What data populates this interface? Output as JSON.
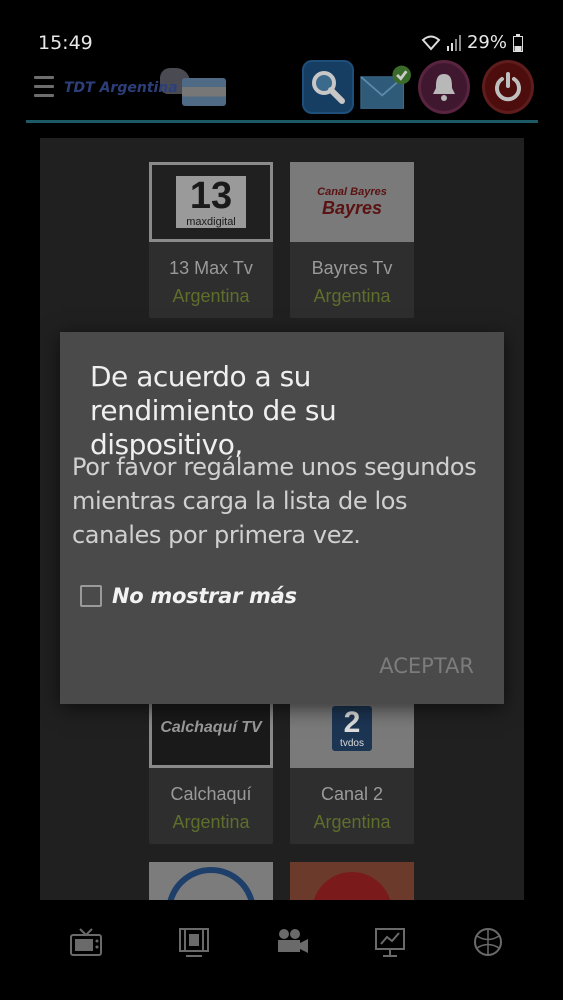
{
  "status": {
    "time": "15:49",
    "battery": "29%"
  },
  "header": {
    "logo_text": "TDT Argentina",
    "icons": [
      "menu-icon",
      "search-icon",
      "mail-icon",
      "bell-icon",
      "power-icon"
    ]
  },
  "channels": [
    {
      "name": "13 Max Tv",
      "country": "Argentina",
      "thumb_text": "13",
      "thumb_sub": "maxdigital"
    },
    {
      "name": "Bayres Tv",
      "country": "Argentina",
      "thumb_text": "Bayres",
      "thumb_sub": "Canal Bayres"
    },
    {
      "name": "Calchaquí",
      "country": "Argentina",
      "thumb_text": "Calchaquí TV"
    },
    {
      "name": "Canal 2",
      "country": "Argentina",
      "thumb_text": "2",
      "thumb_sub": "tvdos"
    }
  ],
  "dialog": {
    "title": "De acuerdo a su rendimiento de su dispositivo,",
    "body": "Por favor regálame unos segundos mientras carga la lista de los canales por primera vez.",
    "checkbox_label": "No mostrar más",
    "accept_label": "ACEPTAR"
  },
  "bottom_nav": [
    "tv-icon",
    "film-icon",
    "camera-icon",
    "presentation-icon",
    "ball-icon"
  ]
}
